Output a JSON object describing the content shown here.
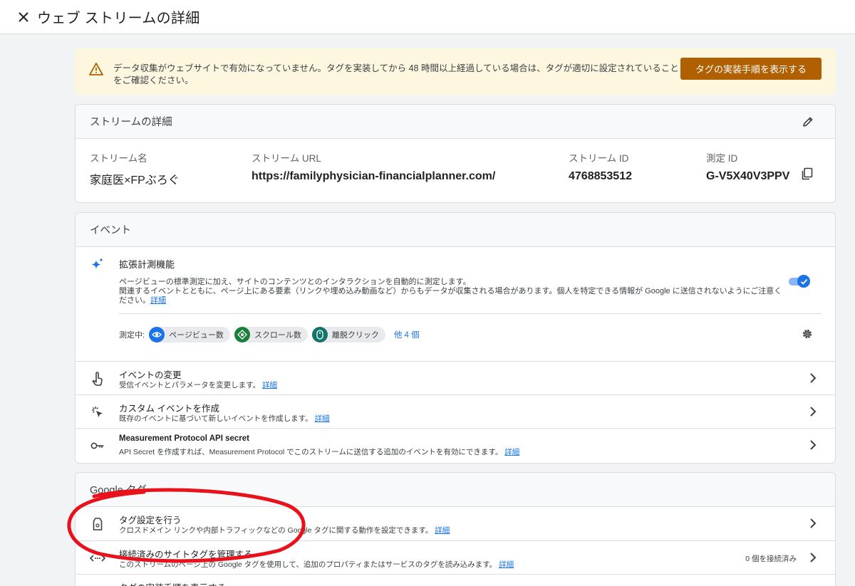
{
  "topbar": {
    "title": "ウェブ ストリームの詳細"
  },
  "warning": {
    "text": "データ収集がウェブサイトで有効になっていません。タグを実装してから 48 時間以上経過している場合は、タグが適切に設定されていることをご確認ください。",
    "button_label": "タグの実装手順を表示する"
  },
  "stream_details": {
    "heading": "ストリームの詳細",
    "name_label": "ストリーム名",
    "name_value": "家庭医×FPぶろぐ",
    "url_label": "ストリーム URL",
    "url_value": "https://familyphysician-financialplanner.com/",
    "id_label": "ストリーム ID",
    "id_value": "4768853512",
    "measurement_id_label": "測定 ID",
    "measurement_id_value": "G-V5X40V3PPV"
  },
  "events": {
    "heading": "イベント",
    "enhanced": {
      "title": "拡張計測機能",
      "desc_line1": "ページビューの標準測定に加え、サイトのコンテンツとのインタラクションを自動的に測定します。",
      "desc_line2": "関連するイベントとともに、ページ上にある要素（リンクや埋め込み動画など）からもデータが収集される場合があります。個人を特定できる情報が Google に送信されないようにご注意ください。",
      "desc_link": "詳細",
      "enabled": true,
      "measuring_label": "測定中:",
      "chips": [
        "ページビュー数",
        "スクロール数",
        "離脱クリック"
      ],
      "more_label": "他 4 個"
    },
    "rows": [
      {
        "title": "イベントの変更",
        "sub": "受信イベントとパラメータを変更します。",
        "link": "詳細",
        "icon": "touch-icon"
      },
      {
        "title": "カスタム イベントを作成",
        "sub": "既存のイベントに基づいて新しいイベントを作成します。",
        "link": "詳細",
        "icon": "sparkle-click-icon"
      },
      {
        "title": "Measurement Protocol API secret",
        "sub": "API Secret を作成すれば、Measurement Protocol でこのストリームに送信する追加のイベントを有効にできます。",
        "link": "詳細",
        "icon": "key-icon"
      }
    ]
  },
  "google_tag": {
    "heading": "Google タグ",
    "rows": [
      {
        "title": "タグ設定を行う",
        "sub": "クロスドメイン リンクや内部トラフィックなどの Google タグに関する動作を設定できます。",
        "link": "詳細",
        "icon": "tag-icon"
      },
      {
        "title": "接続済みのサイトタグを管理する",
        "sub": "このストリームのページ上の Google タグを使用して、追加のプロパティまたはサービスのタグを読み込みます。",
        "link": "詳細",
        "badge": "0 個を接続済み",
        "icon": "code-arrows-icon"
      },
      {
        "title": "タグの実装手順を表示する",
        "sub": "",
        "link": "",
        "icon": "code-icon"
      }
    ]
  },
  "colors": {
    "primary": "#1a73e8",
    "warning_bg": "#fef7e0",
    "warning_button": "#b06000",
    "annotation": "#e8111c"
  }
}
